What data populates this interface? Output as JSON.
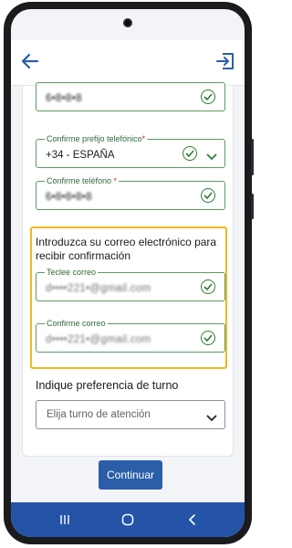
{
  "header": {
    "back_icon": "arrow-left-icon",
    "exit_icon": "exit-icon",
    "accent": "#2a5ea8"
  },
  "form": {
    "top_field": {
      "value": "6•8•8•8"
    },
    "prefix_field": {
      "label": "Confirme prefijo telefónico",
      "required_mark": "*",
      "value": "+34 - ESPAÑA"
    },
    "phone_field": {
      "label": "Confirme teléfono ",
      "required_mark": "*",
      "value": "6•8•8•8•8"
    },
    "email_section": {
      "title": "Introduzca su correo electrónico para recibir confirmación",
      "email_field": {
        "label": "Teclee correo",
        "value_blur": "d••••221•",
        "value_domain": "@gmail.com"
      },
      "confirm_email_field": {
        "label": "Confirme correo",
        "value_blur": "d••••221•",
        "value_domain": "@gmail.com"
      }
    },
    "turn_section": {
      "title": "Indique preferencia de turno",
      "select_placeholder": "Elija turno de atención"
    }
  },
  "actions": {
    "continue_label": "Continuar"
  },
  "colors": {
    "valid_green": "#2e7d32",
    "highlight_border": "#f0b81c",
    "nav_bar": "#2553a7",
    "button": "#2a5ea8"
  },
  "navbar_icons": [
    "recents-icon",
    "home-icon",
    "back-nav-icon"
  ]
}
